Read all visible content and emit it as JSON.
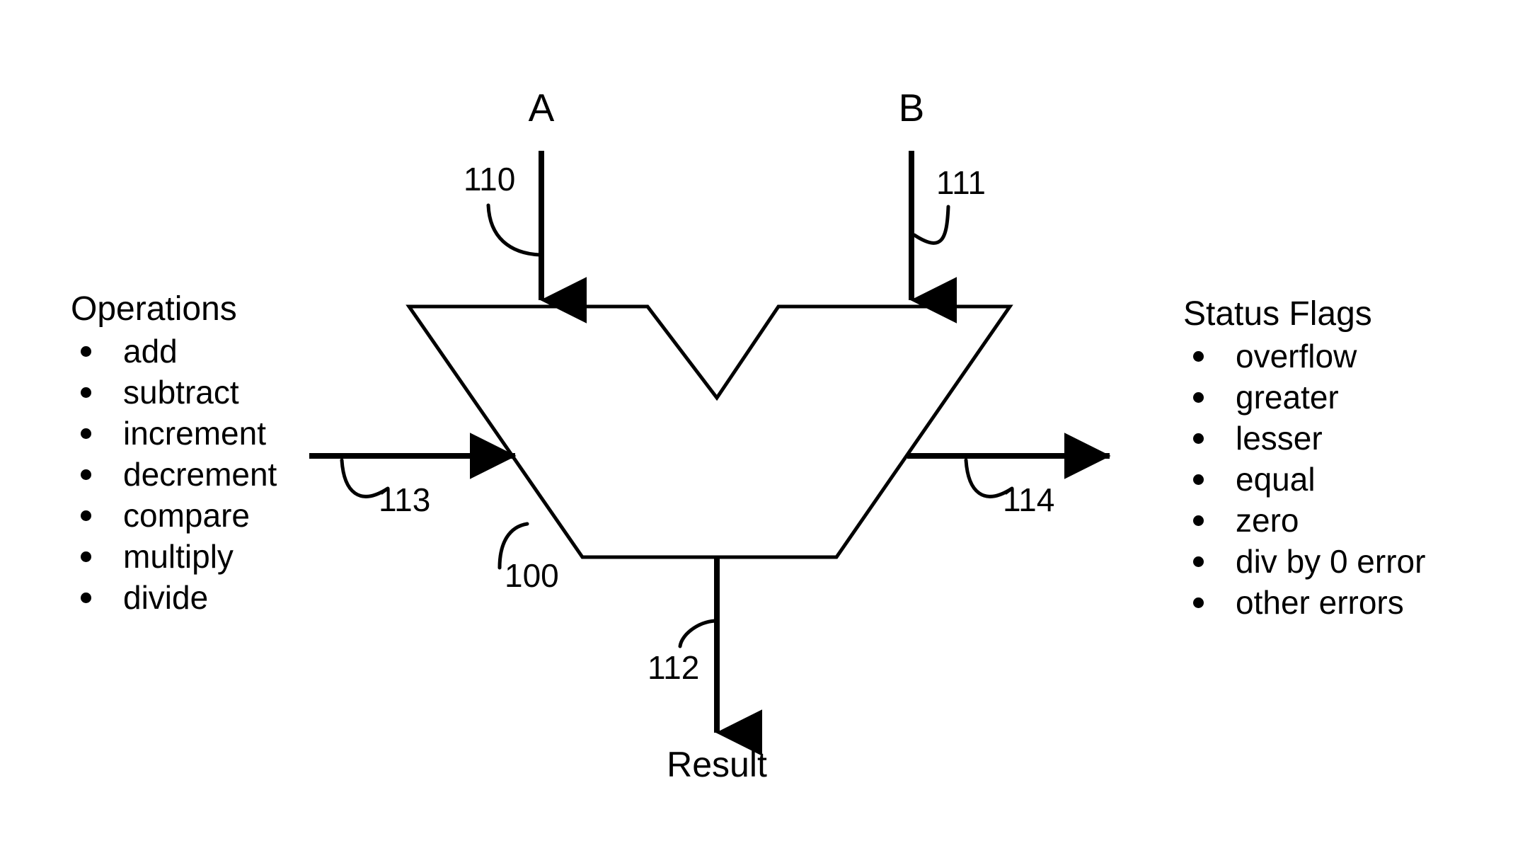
{
  "diagram": {
    "title": "ALU block diagram",
    "stroke_color": "#000000",
    "background_color": "#ffffff"
  },
  "inputs": {
    "a_label": "A",
    "b_label": "B",
    "a_ref": "110",
    "b_ref": "111"
  },
  "outputs": {
    "result_label": "Result",
    "result_ref": "112"
  },
  "alu": {
    "ref": "100"
  },
  "operations": {
    "heading": "Operations",
    "ref": "113",
    "items": [
      {
        "label": "add"
      },
      {
        "label": "subtract"
      },
      {
        "label": "increment"
      },
      {
        "label": "decrement"
      },
      {
        "label": "compare"
      },
      {
        "label": "multiply"
      },
      {
        "label": "divide"
      }
    ]
  },
  "status_flags": {
    "heading": "Status Flags",
    "ref": "114",
    "items": [
      {
        "label": "overflow"
      },
      {
        "label": "greater"
      },
      {
        "label": "lesser"
      },
      {
        "label": "equal"
      },
      {
        "label": "zero"
      },
      {
        "label": "div by 0 error"
      },
      {
        "label": "other errors"
      }
    ]
  }
}
